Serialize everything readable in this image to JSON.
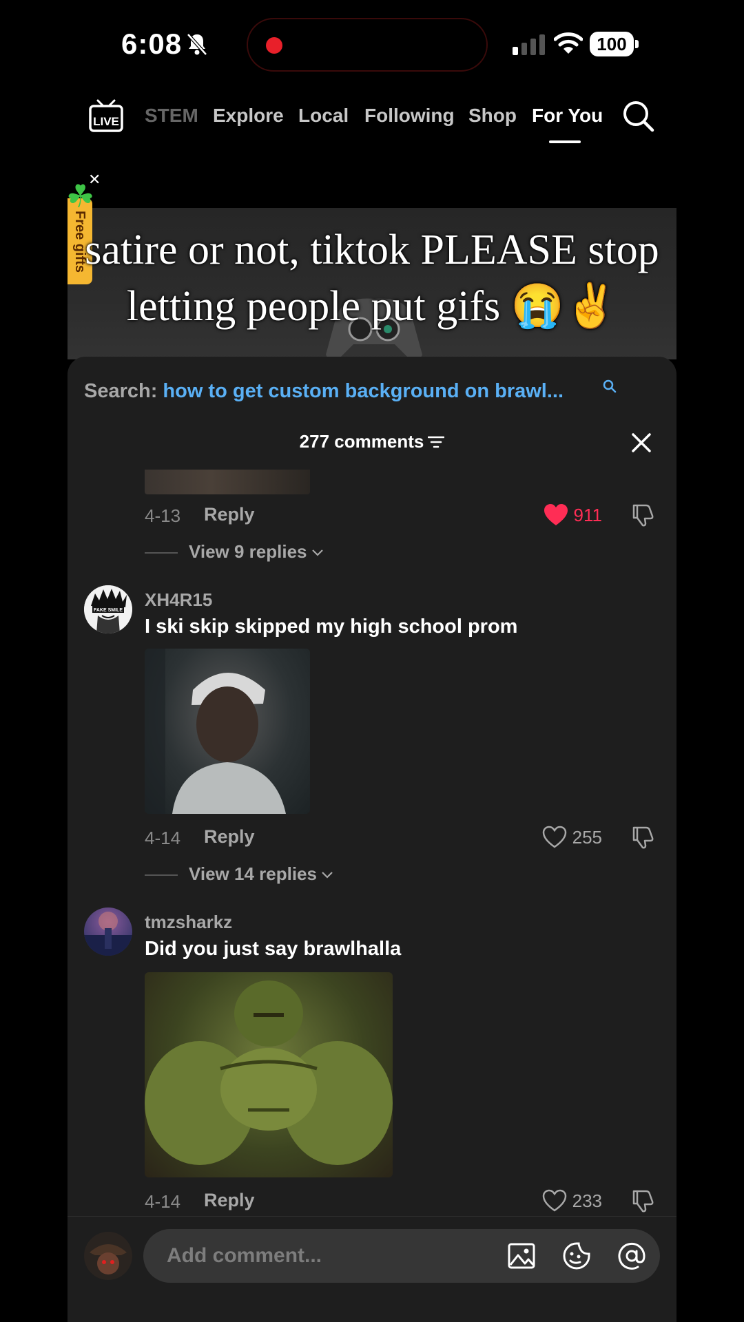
{
  "status_bar": {
    "time": "6:08",
    "battery": "100",
    "icons": [
      "bell-slash-icon",
      "recording-dot",
      "cellular-signal-icon",
      "wifi-icon",
      "battery-icon"
    ]
  },
  "nav": {
    "live_label": "LIVE",
    "tabs": [
      "STEM",
      "Explore",
      "Local",
      "Following",
      "Shop",
      "For You"
    ],
    "active_tab": "For You"
  },
  "gift_banner": {
    "label": "Free gifts"
  },
  "video": {
    "caption": "satire or not, tiktok PLEASE stop letting people put gifs 😭✌️"
  },
  "comments_panel": {
    "search_prefix": "Search:",
    "search_query": "how to get custom background on brawl...",
    "count_label": "277 comments",
    "comments": [
      {
        "date": "4-13",
        "reply_label": "Reply",
        "likes": "911",
        "liked": true,
        "view_replies": "View 9 replies"
      },
      {
        "username": "XH4R15",
        "text": "I ski skip skipped my high school prom",
        "date": "4-14",
        "reply_label": "Reply",
        "likes": "255",
        "liked": false,
        "view_replies": "View 14 replies"
      },
      {
        "username": "tmzsharkz",
        "text": "Did you just say brawlhalla",
        "date": "4-14",
        "reply_label": "Reply",
        "likes": "233",
        "liked": false
      }
    ],
    "avatar_text": "FAKE SMILE"
  },
  "input": {
    "placeholder": "Add comment..."
  },
  "colors": {
    "accent_blue": "#5ab0f5",
    "like_red": "#ff2d55",
    "panel_bg": "#1e1e1e",
    "record_red": "#e8202a"
  }
}
